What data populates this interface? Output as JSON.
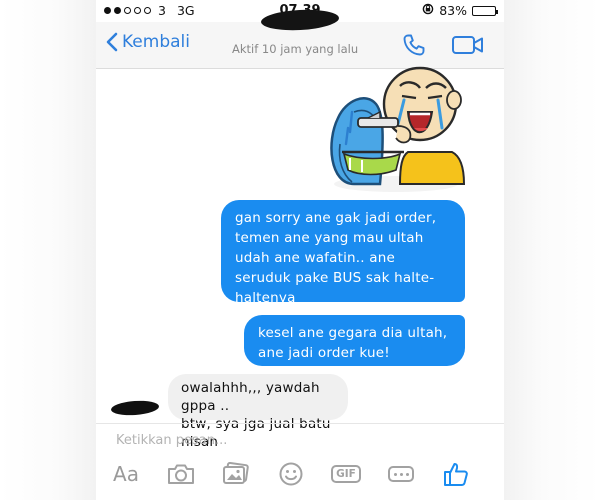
{
  "status_bar": {
    "carrier": "3",
    "network": "3G",
    "time": "07.39",
    "battery_percent": "83%",
    "battery_level": 0.83,
    "signal_dots_filled": 2,
    "signal_dots_total": 5
  },
  "nav": {
    "back_label": "Kembali",
    "subtitle": "Aktif 10 jam yang lalu"
  },
  "messages": [
    {
      "direction": "outgoing",
      "type": "sticker",
      "sticker": "crying-man-sticker"
    },
    {
      "direction": "outgoing",
      "type": "text",
      "text": "gan sorry ane gak jadi order,\ntemen ane yang mau ultah\nudah ane wafatin.. ane\nseruduk pake BUS sak halte-\nhaltenya"
    },
    {
      "direction": "outgoing",
      "type": "text",
      "text": "kesel ane gegara dia ultah,\nane jadi order kue!"
    },
    {
      "direction": "incoming",
      "type": "text",
      "text": "owalahhh,,, yawdah gppa ..\nbtw, sya jga jual batu nisan"
    }
  ],
  "composer": {
    "placeholder": "Ketikkan pesan..."
  },
  "toolbar": {
    "text_label": "Aa",
    "gif_label": "GIF",
    "icons": [
      "text-format-icon",
      "camera-icon",
      "gallery-icon",
      "emoji-icon",
      "gif-icon",
      "more-icon",
      "like-icon"
    ]
  },
  "colors": {
    "accent": "#2f7fdc",
    "outgoing_bubble": "#1a8cf0",
    "incoming_bubble": "#f0f0f0",
    "toolbar_icon": "#a2a2a2",
    "like_icon": "#1a8cf0"
  }
}
